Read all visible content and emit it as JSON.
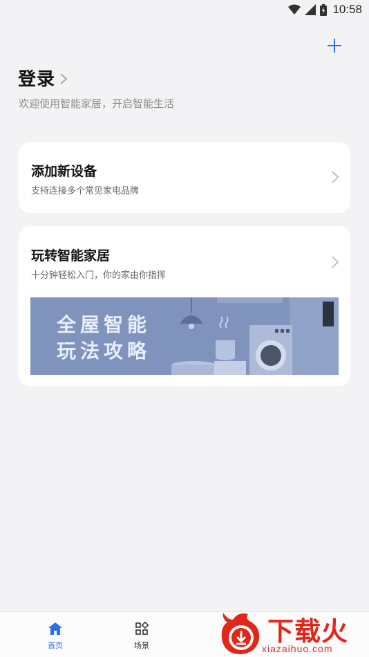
{
  "status_bar": {
    "time": "10:58"
  },
  "header": {
    "login_title": "登录",
    "login_subtitle": "欢迎使用智能家居，开启智能生活"
  },
  "cards": {
    "add_device": {
      "title": "添加新设备",
      "subtitle": "支持连接多个常见家电品牌"
    },
    "play_smart_home": {
      "title": "玩转智能家居",
      "subtitle": "十分钟轻松入门，你的家由你指挥",
      "banner_line1": "全屋智能",
      "banner_line2": "玩法攻略"
    }
  },
  "bottom_nav": {
    "items": [
      {
        "label": "首页",
        "icon": "home-icon",
        "active": true
      },
      {
        "label": "场景",
        "icon": "scene-grid-icon",
        "active": false
      }
    ]
  },
  "watermark": {
    "brand": "下载火",
    "domain": "xiazaihuo.com"
  },
  "colors": {
    "accent": "#2a6ff0",
    "background": "#f3f3f5",
    "card": "#ffffff",
    "banner": "#7f93bd",
    "watermark": "#e2261a"
  }
}
